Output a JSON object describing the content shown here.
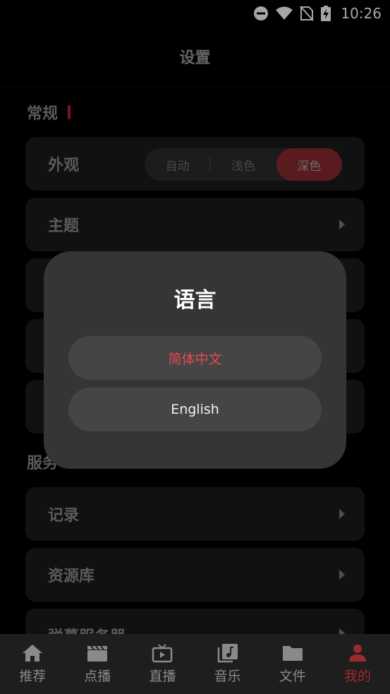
{
  "status_bar": {
    "time": "10:26"
  },
  "header": {
    "title": "设置"
  },
  "sections": {
    "general": "常规",
    "services": "服务"
  },
  "appearance": {
    "label": "外观",
    "options": [
      "自动",
      "浅色",
      "深色"
    ],
    "selected": "深色"
  },
  "general_items": {
    "theme": "主题"
  },
  "service_items": [
    "记录",
    "资源库",
    "弹幕服务器"
  ],
  "dialog": {
    "title": "语言",
    "options": [
      "简体中文",
      "English"
    ],
    "selected": "简体中文"
  },
  "tabbar": {
    "items": [
      "推荐",
      "点播",
      "直播",
      "音乐",
      "文件",
      "我的"
    ],
    "active": "我的"
  },
  "colors": {
    "accent": "#b3262c",
    "selected_text": "#e84a4f"
  }
}
